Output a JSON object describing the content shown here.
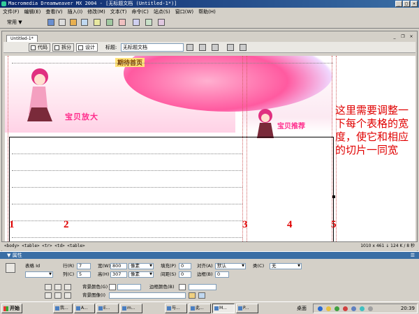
{
  "window": {
    "title": "Macromedia Dreamweaver MX 2004 - [无标题文档 (Untitled-1*)]"
  },
  "menu": [
    "文件(F)",
    "编辑(E)",
    "查看(V)",
    "插入(I)",
    "修改(M)",
    "文本(T)",
    "命令(C)",
    "站点(S)",
    "窗口(W)",
    "帮助(H)"
  ],
  "toolbar": {
    "category": "常用 ▼"
  },
  "document": {
    "tab": "Untitled-1*",
    "views": [
      "代码",
      "拆分",
      "设计"
    ],
    "title_label": "标题:",
    "title_value": "无标题文档"
  },
  "canvas": {
    "banner_text": "期待首页",
    "tag_left": "宝贝放大",
    "tag_right": "宝贝推荐",
    "column_numbers": [
      "1",
      "2",
      "3",
      "4",
      "5"
    ],
    "annotation": "这里需要调整一下每个表格的宽度，使它和相应的切片一同宽"
  },
  "status": {
    "tags": "<body> <table> <tr> <td> <table>",
    "size": "1010 x 461 ↓ 124 K / 8 秒"
  },
  "properties": {
    "header": "▼ 属性",
    "table_id_label": "表格 Id",
    "rows_label": "行(R)",
    "rows": "7",
    "cols_label": "列(C)",
    "cols": "5",
    "width_label": "宽(W)",
    "width": "800",
    "width_unit": "像素",
    "height_label": "高(H)",
    "height": "307",
    "height_unit": "像素",
    "padding_label": "填充(P)",
    "padding": "0",
    "spacing_label": "间距(S)",
    "spacing": "0",
    "align_label": "对齐(A)",
    "align": "默认",
    "border_label": "边框(B)",
    "border": "0",
    "class_label": "类(C)",
    "class": "无",
    "bgcolor_label": "背景颜色(G)",
    "bordercolor_label": "边框颜色(B)",
    "bgimage_label": "背景图像(I)"
  },
  "taskbar": {
    "start": "开始",
    "items": [
      "我...",
      "A...",
      "E...",
      "m...",
      "与...",
      "此...",
      "M...",
      "P..."
    ],
    "desktop": "桌面",
    "clock": "20:39"
  }
}
